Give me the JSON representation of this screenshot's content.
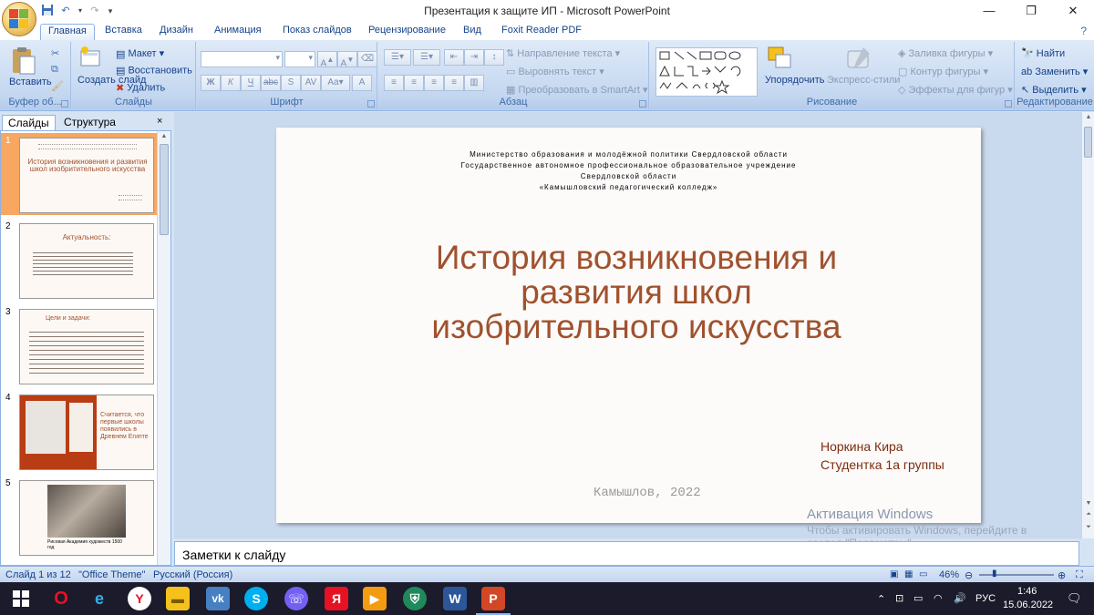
{
  "window": {
    "title": "Презентация к защите ИП - Microsoft PowerPoint"
  },
  "quick_access": [
    "save-icon",
    "undo-icon",
    "redo-icon",
    "customize-icon"
  ],
  "tabs": [
    "Главная",
    "Вставка",
    "Дизайн",
    "Анимация",
    "Показ слайдов",
    "Рецензирование",
    "Вид",
    "Foxit Reader PDF"
  ],
  "ribbon": {
    "clipboard": {
      "label": "Буфер об...",
      "paste": "Вставить"
    },
    "slides": {
      "label": "Слайды",
      "new_slide": "Создать слайд",
      "layout": "Макет",
      "reset": "Восстановить",
      "delete": "Удалить"
    },
    "font": {
      "label": "Шрифт"
    },
    "paragraph": {
      "label": "Абзац",
      "text_direction": "Направление текста",
      "align_text": "Выровнять текст",
      "smartart": "Преобразовать в SmartArt"
    },
    "drawing": {
      "label": "Рисование",
      "arrange": "Упорядочить",
      "quick_styles": "Экспресс-стили",
      "shape_fill": "Заливка фигуры",
      "shape_outline": "Контур фигуры",
      "shape_effects": "Эффекты для фигур"
    },
    "editing": {
      "label": "Редактирование",
      "find": "Найти",
      "replace": "Заменить",
      "select": "Выделить"
    }
  },
  "left_pane": {
    "tabs": [
      "Слайды",
      "Структура"
    ],
    "close": "×",
    "thumbnails": [
      {
        "num": "1",
        "title": "История возникновения и развития школ изобритительного искусства"
      },
      {
        "num": "2",
        "title": "Актуальность:"
      },
      {
        "num": "3",
        "title": "Цели и задачи:"
      },
      {
        "num": "4",
        "title": "Считается, что первые школы появились в Древнем Египте"
      },
      {
        "num": "5",
        "caption": "Рисовая Академия художеств 1500 год"
      }
    ]
  },
  "slide": {
    "header_lines": [
      "Министерство образования и молодёжной политики Свердловской области",
      "Государственное автономное профессиональное образовательное учреждение",
      "Свердловской области",
      "«Камышловский педагогический колледж»"
    ],
    "title_lines": [
      "История возникновения и",
      "развития школ",
      "изобрительного искусства"
    ],
    "author": "Норкина Кира",
    "group": "Студентка 1а группы",
    "footer": "Камышлов, 2022"
  },
  "notes_placeholder": "Заметки к слайду",
  "activation": {
    "title": "Активация Windows",
    "line1": "Чтобы активировать Windows, перейдите в",
    "line2": "раздел \"Параметры\"."
  },
  "status": {
    "slide_of": "Слайд 1 из 12",
    "theme": "\"Office Theme\"",
    "language": "Русский (Россия)",
    "zoom": "46%"
  },
  "taskbar": {
    "lang": "РУС",
    "time": "1:46",
    "date": "15.06.2022"
  },
  "colors": {
    "title": "#a0522d",
    "accent": "#15428b"
  }
}
